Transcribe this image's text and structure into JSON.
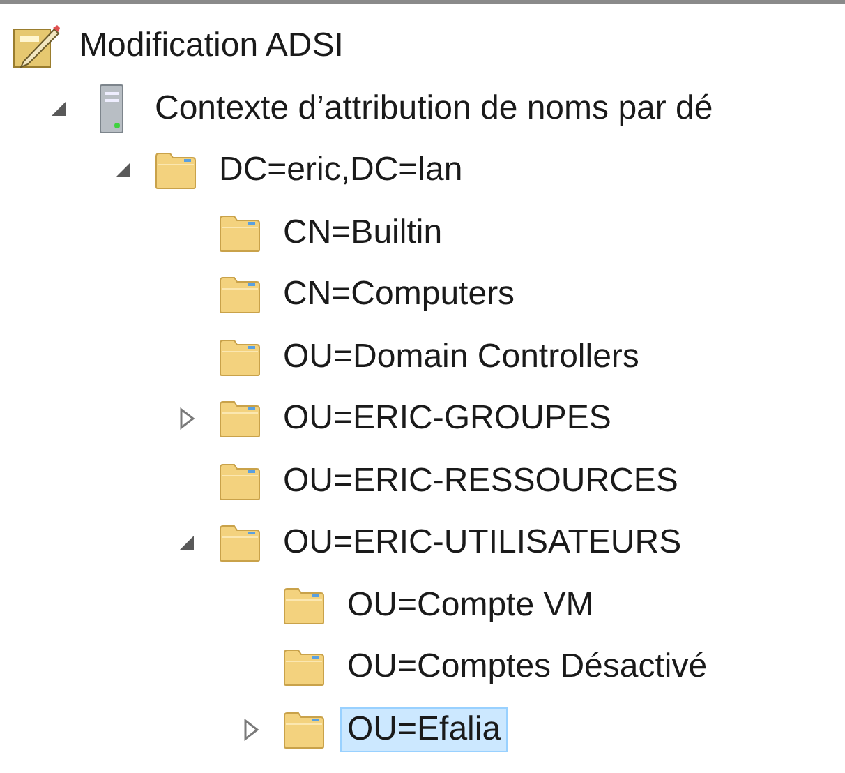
{
  "tree": [
    {
      "label": "Modification ADSI",
      "kind": "edit",
      "selected": false,
      "children": [
        {
          "label": "Contexte d’attribution de noms par dé",
          "kind": "server",
          "expandable": true,
          "expanded": true,
          "selected": false,
          "children": [
            {
              "label": "DC=eric,DC=lan",
              "kind": "folder",
              "expandable": true,
              "expanded": true,
              "selected": false,
              "children": [
                {
                  "label": "CN=Builtin",
                  "kind": "folder",
                  "expandable": false,
                  "selected": false
                },
                {
                  "label": "CN=Computers",
                  "kind": "folder",
                  "expandable": false,
                  "selected": false
                },
                {
                  "label": "OU=Domain Controllers",
                  "kind": "folder",
                  "expandable": false,
                  "selected": false
                },
                {
                  "label": "OU=ERIC-GROUPES",
                  "kind": "folder",
                  "expandable": true,
                  "expanded": false,
                  "selected": false
                },
                {
                  "label": "OU=ERIC-RESSOURCES",
                  "kind": "folder",
                  "expandable": false,
                  "selected": false
                },
                {
                  "label": "OU=ERIC-UTILISATEURS",
                  "kind": "folder",
                  "expandable": true,
                  "expanded": true,
                  "selected": false,
                  "children": [
                    {
                      "label": "OU=Compte VM",
                      "kind": "folder",
                      "expandable": false,
                      "selected": false
                    },
                    {
                      "label": "OU=Comptes Désactivé",
                      "kind": "folder",
                      "expandable": false,
                      "selected": false
                    },
                    {
                      "label": "OU=Efalia",
                      "kind": "folder",
                      "expandable": true,
                      "expanded": false,
                      "selected": true
                    }
                  ]
                }
              ]
            }
          ]
        }
      ]
    }
  ]
}
